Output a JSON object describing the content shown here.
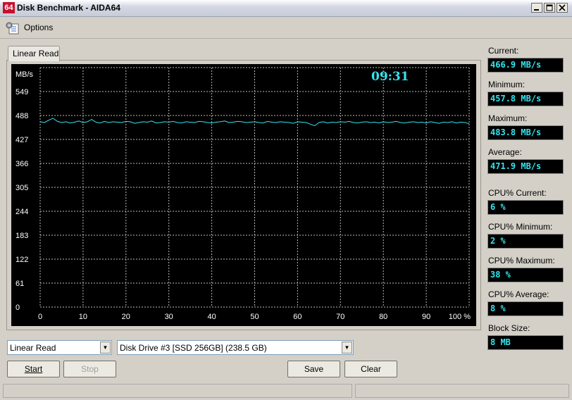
{
  "window": {
    "app_icon": "64",
    "title": "Disk Benchmark - AIDA64",
    "minimize_glyph": "0",
    "maximize_glyph": "1",
    "close_glyph": "r"
  },
  "menu": {
    "options_label": "Options",
    "options_icon": "options-icon"
  },
  "tab": {
    "label": "Linear Read"
  },
  "graph": {
    "clock": "09:31",
    "colors": {
      "background": "#000000",
      "line": "#35e4ef",
      "grid": "#bbbbbb",
      "labels": "#ffffff"
    }
  },
  "chart_data": {
    "type": "line",
    "ylabel": "MB/s",
    "y_ticks": [
      "0",
      "61",
      "122",
      "183",
      "244",
      "305",
      "366",
      "427",
      "488",
      "549"
    ],
    "x_ticks": [
      "0",
      "10",
      "20",
      "30",
      "40",
      "50",
      "60",
      "70",
      "80",
      "90",
      "100 %"
    ],
    "ylim": [
      0,
      610
    ],
    "xlim": [
      0,
      100
    ],
    "grid": true,
    "series": [
      {
        "values": [
          472,
          470,
          476,
          481,
          473,
          470,
          472,
          469,
          471,
          474,
          470,
          472,
          478,
          471,
          469,
          473,
          470,
          472,
          471,
          470,
          473,
          472,
          468,
          470,
          472,
          471,
          474,
          469,
          470,
          472,
          471,
          473,
          470,
          469,
          472,
          471,
          470,
          473,
          472,
          470,
          469,
          471,
          472,
          474,
          470,
          471,
          473,
          472,
          470,
          471,
          472,
          470,
          469,
          473,
          471,
          470,
          472,
          471,
          470,
          468,
          472,
          471,
          470,
          466,
          462,
          470,
          472,
          469,
          471,
          470,
          472,
          471,
          473,
          470,
          469,
          471,
          472,
          470,
          471,
          469,
          472,
          470,
          471,
          473,
          470,
          469,
          471,
          472,
          470,
          471,
          469,
          472,
          470,
          468,
          471,
          470,
          472,
          469,
          471,
          470,
          467
        ]
      }
    ]
  },
  "stats": {
    "current_label": "Current:",
    "current": "466.9 MB/s",
    "minimum_label": "Minimum:",
    "minimum": "457.8 MB/s",
    "maximum_label": "Maximum:",
    "maximum": "483.8 MB/s",
    "average_label": "Average:",
    "average": "471.9 MB/s",
    "cpu_current_label": "CPU% Current:",
    "cpu_current": "6 %",
    "cpu_minimum_label": "CPU% Minimum:",
    "cpu_minimum": "2 %",
    "cpu_maximum_label": "CPU% Maximum:",
    "cpu_maximum": "38 %",
    "cpu_average_label": "CPU% Average:",
    "cpu_average": "8 %",
    "block_size_label": "Block Size:",
    "block_size": "8 MB"
  },
  "controls": {
    "test_select": "Linear Read",
    "drive_select": "Disk Drive #3  [SSD 256GB]  (238.5 GB)",
    "start_label": "Start",
    "stop_label": "Stop",
    "save_label": "Save",
    "clear_label": "Clear"
  }
}
